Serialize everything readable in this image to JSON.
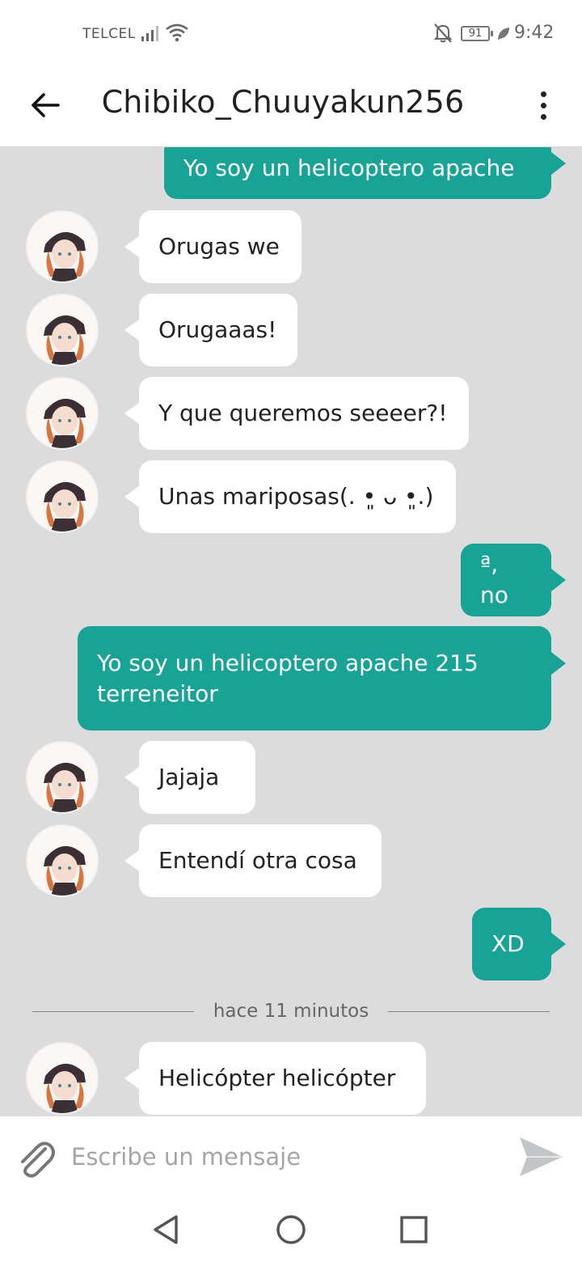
{
  "status_bar": {
    "carrier": "TELCEL",
    "battery": "91",
    "time": "9:42"
  },
  "header": {
    "title": "Chibiko_Chuuyakun256"
  },
  "messages": [
    {
      "side": "out",
      "text": "Yo soy un helicoptero apache"
    },
    {
      "side": "in",
      "text": "Orugas we"
    },
    {
      "side": "in",
      "text": "Orugaaas!"
    },
    {
      "side": "in",
      "text": "Y que queremos seeeer?!"
    },
    {
      "side": "in",
      "text": "Unas mariposas(. •͈ ᴗ •͈.)"
    },
    {
      "side": "out",
      "text": "ª, no"
    },
    {
      "side": "out",
      "text": "Yo soy un helicoptero apache 215 terreneitor"
    },
    {
      "side": "in",
      "text": "Jajaja"
    },
    {
      "side": "in",
      "text": "Entendí otra cosa"
    },
    {
      "side": "out",
      "text": "XD"
    },
    {
      "side": "in",
      "text": "Helicópter helicópter"
    }
  ],
  "divider": "hace 11 minutos",
  "composer": {
    "placeholder": "Escribe un mensaje"
  },
  "icons": {
    "back": "arrow-left-icon",
    "menu": "more-vertical-icon",
    "attach": "paperclip-icon",
    "send": "send-icon",
    "nav_back": "triangle-back-icon",
    "nav_home": "circle-home-icon",
    "nav_recent": "square-recent-icon"
  },
  "colors": {
    "outgoing": "#17a497",
    "incoming": "#ffffff",
    "background": "#dcdcdc"
  }
}
